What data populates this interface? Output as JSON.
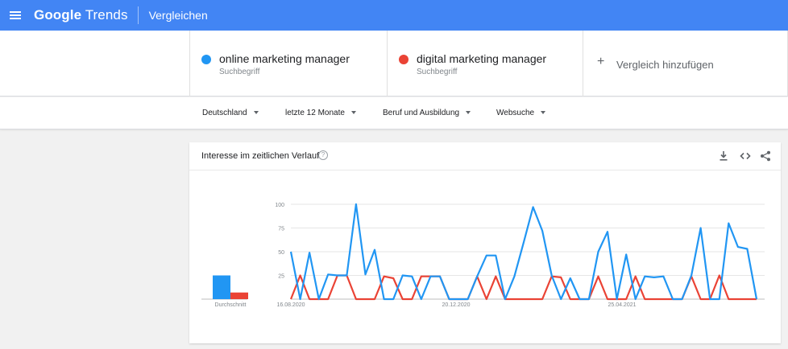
{
  "header": {
    "brand_google": "Google",
    "brand_trends": "Trends",
    "page_title": "Vergleichen"
  },
  "terms": [
    {
      "name": "online marketing manager",
      "type": "Suchbegriff",
      "color": "#2196f3"
    },
    {
      "name": "digital marketing manager",
      "type": "Suchbegriff",
      "color": "#ea4335"
    }
  ],
  "add_compare": {
    "plus": "+",
    "label": "Vergleich hinzufügen"
  },
  "filters": {
    "region": "Deutschland",
    "time": "letzte 12 Monate",
    "category": "Beruf und Ausbildung",
    "search_type": "Websuche"
  },
  "card": {
    "title": "Interesse im zeitlichen Verlauf",
    "help": "?",
    "icons": [
      "download-icon",
      "embed-icon",
      "share-icon"
    ]
  },
  "chart_data": {
    "type": "line",
    "average_label": "Durchschnitt",
    "averages": [
      25,
      7
    ],
    "x_tick_labels": [
      "16.08.2020",
      "20.12.2020",
      "25.04.2021"
    ],
    "y_ticks": [
      100,
      75,
      50,
      25
    ],
    "ylim": [
      0,
      100
    ],
    "grid": true,
    "series": [
      {
        "name": "online marketing manager",
        "color": "#2196f3",
        "values": [
          50,
          0,
          49,
          0,
          26,
          25,
          25,
          100,
          26,
          52,
          0,
          0,
          25,
          24,
          0,
          24,
          24,
          0,
          0,
          0,
          24,
          46,
          46,
          0,
          24,
          60,
          97,
          72,
          25,
          0,
          22,
          0,
          0,
          50,
          71,
          0,
          47,
          0,
          24,
          23,
          24,
          0,
          0,
          25,
          75,
          0,
          0,
          80,
          55,
          53,
          0
        ]
      },
      {
        "name": "digital marketing manager",
        "color": "#ea4335",
        "values": [
          0,
          25,
          0,
          0,
          0,
          25,
          25,
          0,
          0,
          0,
          24,
          22,
          0,
          0,
          24,
          24,
          24,
          0,
          0,
          0,
          24,
          0,
          24,
          0,
          0,
          0,
          0,
          0,
          24,
          23,
          0,
          0,
          0,
          24,
          0,
          0,
          0,
          24,
          0,
          0,
          0,
          0,
          0,
          24,
          0,
          0,
          25,
          0,
          0,
          0,
          0
        ]
      }
    ]
  }
}
